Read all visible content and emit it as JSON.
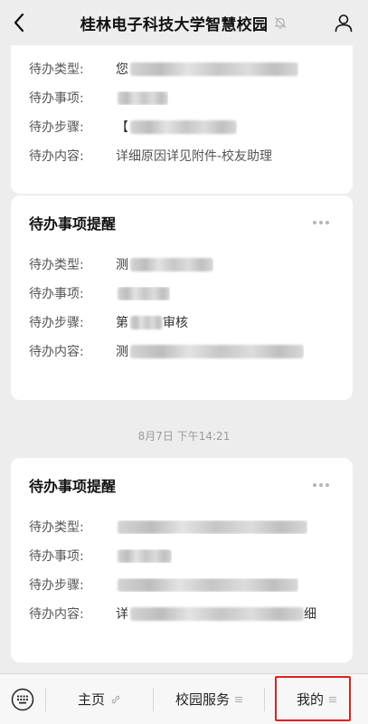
{
  "header": {
    "title": "桂林电子科技大学智慧校园",
    "back_icon": "chevron-left-icon",
    "mute_icon": "bell-off-icon",
    "profile_icon": "person-icon"
  },
  "labels": {
    "type": "待办类型:",
    "item": "待办事项:",
    "step": "待办步骤:",
    "content": "待办内容:"
  },
  "cards": [
    {
      "title": "",
      "rows": [
        {
          "prefix": "您",
          "blur_width": 186,
          "suffix": ""
        },
        {
          "prefix": "",
          "blur_width": 56,
          "suffix": ""
        },
        {
          "prefix": "【",
          "blur_width": 118,
          "suffix": ""
        },
        {
          "prefix": "详细原因详见附件-校友助理",
          "blur_width": 0,
          "suffix": ""
        }
      ]
    },
    {
      "title": "待办事项提醒",
      "rows": [
        {
          "prefix": "测",
          "blur_width": 92,
          "suffix": ""
        },
        {
          "prefix": "",
          "blur_width": 58,
          "suffix": ""
        },
        {
          "prefix": "第",
          "blur_width": 36,
          "suffix": "审核"
        },
        {
          "prefix": "测",
          "blur_width": 192,
          "suffix": ""
        }
      ]
    },
    {
      "title": "待办事项提醒",
      "rows": [
        {
          "prefix": "",
          "blur_width": 210,
          "suffix": ""
        },
        {
          "prefix": "",
          "blur_width": 60,
          "suffix": ""
        },
        {
          "prefix": "",
          "blur_width": 200,
          "suffix": ""
        },
        {
          "prefix": "详",
          "blur_width": 192,
          "suffix": "细"
        }
      ]
    }
  ],
  "timestamp": "8月7日 下午14:21",
  "bottom_bar": {
    "keyboard_icon": "keyboard-icon",
    "menus": [
      {
        "label": "主页",
        "icon": "link-icon"
      },
      {
        "label": "校园服务",
        "icon": "menu-lines-icon"
      },
      {
        "label": "我的",
        "icon": "menu-lines-icon"
      }
    ]
  },
  "colors": {
    "background": "#ededed",
    "card": "#ffffff",
    "highlight": "#e02020"
  }
}
